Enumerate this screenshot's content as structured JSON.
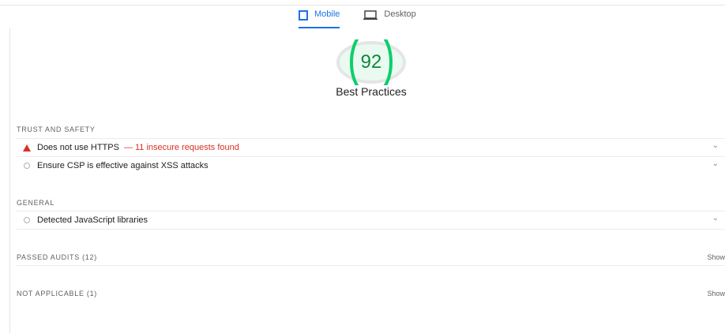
{
  "tabs": [
    {
      "label": "Mobile",
      "active": true,
      "icon": "phone-icon"
    },
    {
      "label": "Desktop",
      "active": false,
      "icon": "desktop-icon"
    }
  ],
  "gauge": {
    "score": "92",
    "title": "Best Practices",
    "color": "#0cce6b",
    "fraction": 0.92
  },
  "groups": {
    "trust": {
      "title": "TRUST AND SAFETY",
      "audits": [
        {
          "label": "Does not use HTTPS",
          "detail": "— 11 insecure requests found",
          "status": "fail"
        },
        {
          "label": "Ensure CSP is effective against XSS attacks",
          "detail": "",
          "status": "informative"
        }
      ]
    },
    "general": {
      "title": "GENERAL",
      "audits": [
        {
          "label": "Detected JavaScript libraries",
          "status": "informative"
        }
      ]
    },
    "passed": {
      "title": "PASSED AUDITS (12)",
      "show_label": "Show"
    },
    "not_applicable": {
      "title": "NOT APPLICABLE (1)",
      "show_label": "Show"
    }
  },
  "colors": {
    "fail": "#d93025",
    "accent": "#1a73e8",
    "pass": "#0cce6b"
  }
}
